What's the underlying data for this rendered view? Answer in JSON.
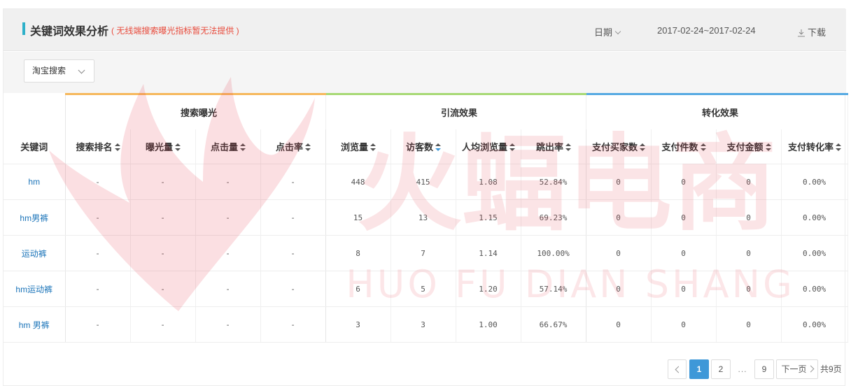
{
  "header": {
    "title": "关键词效果分析",
    "note": "( 无线端搜索曝光指标暂无法提供 )",
    "date_label": "日期",
    "date_range": "2017-02-24~2017-02-24",
    "download_label": "下载"
  },
  "filter": {
    "source_selected": "淘宝搜索"
  },
  "watermark": {
    "cn": "火蝠电商",
    "en": "HUO FU DIAN SHANG"
  },
  "groups": {
    "search": "搜索曝光",
    "traffic": "引流效果",
    "conversion": "转化效果"
  },
  "columns": {
    "keyword": "关键词",
    "rank": "搜索排名",
    "impressions": "曝光量",
    "clicks": "点击量",
    "ctr": "点击率",
    "pageviews": "浏览量",
    "visitors": "访客数",
    "pv_per_visitor": "人均浏览量",
    "bounce": "跳出率",
    "buyers": "支付买家数",
    "items": "支付件数",
    "amount": "支付金额",
    "conv_rate": "支付转化率"
  },
  "rows": [
    {
      "keyword": "hm",
      "rank": "-",
      "impressions": "-",
      "clicks": "-",
      "ctr": "-",
      "pageviews": "448",
      "visitors": "415",
      "pv_per_visitor": "1.08",
      "bounce": "52.84%",
      "buyers": "0",
      "items": "0",
      "amount": "0",
      "conv_rate": "0.00%"
    },
    {
      "keyword": "hm男裤",
      "rank": "-",
      "impressions": "-",
      "clicks": "-",
      "ctr": "-",
      "pageviews": "15",
      "visitors": "13",
      "pv_per_visitor": "1.15",
      "bounce": "69.23%",
      "buyers": "0",
      "items": "0",
      "amount": "0",
      "conv_rate": "0.00%"
    },
    {
      "keyword": "运动裤",
      "rank": "-",
      "impressions": "-",
      "clicks": "-",
      "ctr": "-",
      "pageviews": "8",
      "visitors": "7",
      "pv_per_visitor": "1.14",
      "bounce": "100.00%",
      "buyers": "0",
      "items": "0",
      "amount": "0",
      "conv_rate": "0.00%"
    },
    {
      "keyword": "hm运动裤",
      "rank": "-",
      "impressions": "-",
      "clicks": "-",
      "ctr": "-",
      "pageviews": "6",
      "visitors": "5",
      "pv_per_visitor": "1.20",
      "bounce": "57.14%",
      "buyers": "0",
      "items": "0",
      "amount": "0",
      "conv_rate": "0.00%"
    },
    {
      "keyword": "hm 男裤",
      "rank": "-",
      "impressions": "-",
      "clicks": "-",
      "ctr": "-",
      "pageviews": "3",
      "visitors": "3",
      "pv_per_visitor": "1.00",
      "bounce": "66.67%",
      "buyers": "0",
      "items": "0",
      "amount": "0",
      "conv_rate": "0.00%"
    }
  ],
  "pagination": {
    "pages": [
      "1",
      "2",
      "9"
    ],
    "current": "1",
    "ellipsis": "...",
    "next_label": "下一页",
    "total_label": "共9页"
  },
  "colors": {
    "accent": "#2eb0c9",
    "search": "#f0a63d",
    "traffic": "#8fc74d",
    "conversion": "#3c9ad8",
    "note": "#e84c3d",
    "link": "#1b74b9",
    "active_page": "#3e98d8"
  }
}
